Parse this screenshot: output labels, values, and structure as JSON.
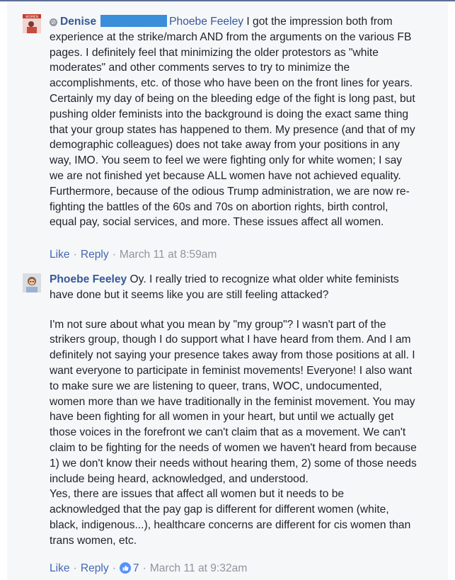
{
  "comments": [
    {
      "author": "Denise",
      "mention": "Phoebe Feeley",
      "paragraphs": [
        "I got the impression both from experience at the strike/march AND from the arguments on the various FB pages. I definitely feel that minimizing the older protestors as \"white moderates\" and other comments serves to try to minimize the accomplishments, etc. of those who have been on the front lines for years. Certainly my day of being on the bleeding edge of the fight is long past, but pushing older feminists into the background is doing the exact same thing that your group states has happened to them. My presence (and that of my demographic colleagues) does not take away from your positions in any way, IMO. You seem to feel we were fighting only for white women; I say we are not finished yet because ALL women have not achieved equality. Furthermore, because of the odious Trump administration, we are now re-fighting the battles of the 60s and 70s on abortion rights, birth control, equal pay, social services, and more. These issues affect all women."
      ],
      "like_label": "Like",
      "reply_label": "Reply",
      "timestamp": "March 11 at 8:59am",
      "avatar_text": "WOMEN"
    },
    {
      "author": "Phoebe Feeley",
      "paragraphs": [
        "Oy. I really tried to recognize what older white feminists have done but it seems like you are still feeling attacked?",
        "I'm not sure about what you mean by \"my group\"? I wasn't part of the strikers group, though I do support what I have heard from them. And I am definitely not saying your presence takes away from those positions at all. I want everyone to participate in feminist movements! Everyone! I also want to make sure we are listening to queer, trans, WOC, undocumented, women more than we have traditionally in the feminist movement. You may have been fighting for all women in your heart, but until we actually get those voices in the forefront we can't claim that as a movement. We can't claim to be fighting for the needs of women we haven't heard from because 1) we don't know their needs without hearing them, 2) some of those needs include being heard, acknowledged, and understood.",
        "Yes, there are issues that affect all women but it needs to be acknowledged that the pay gap is different for different women (white, black, indigenous...), healthcare concerns are different for cis women than trans women, etc."
      ],
      "like_label": "Like",
      "reply_label": "Reply",
      "reaction_count": "7",
      "timestamp": "March 11 at 9:32am"
    }
  ],
  "separator": "·",
  "colors": {
    "name_link": "#365899",
    "action_link": "#4267b2",
    "meta": "#90949c",
    "background": "#f6f7f9",
    "redaction": "#3b8ed9",
    "like_badge": "#5890ff"
  },
  "icons": [
    "pending-icon",
    "thumbs-up-icon"
  ]
}
